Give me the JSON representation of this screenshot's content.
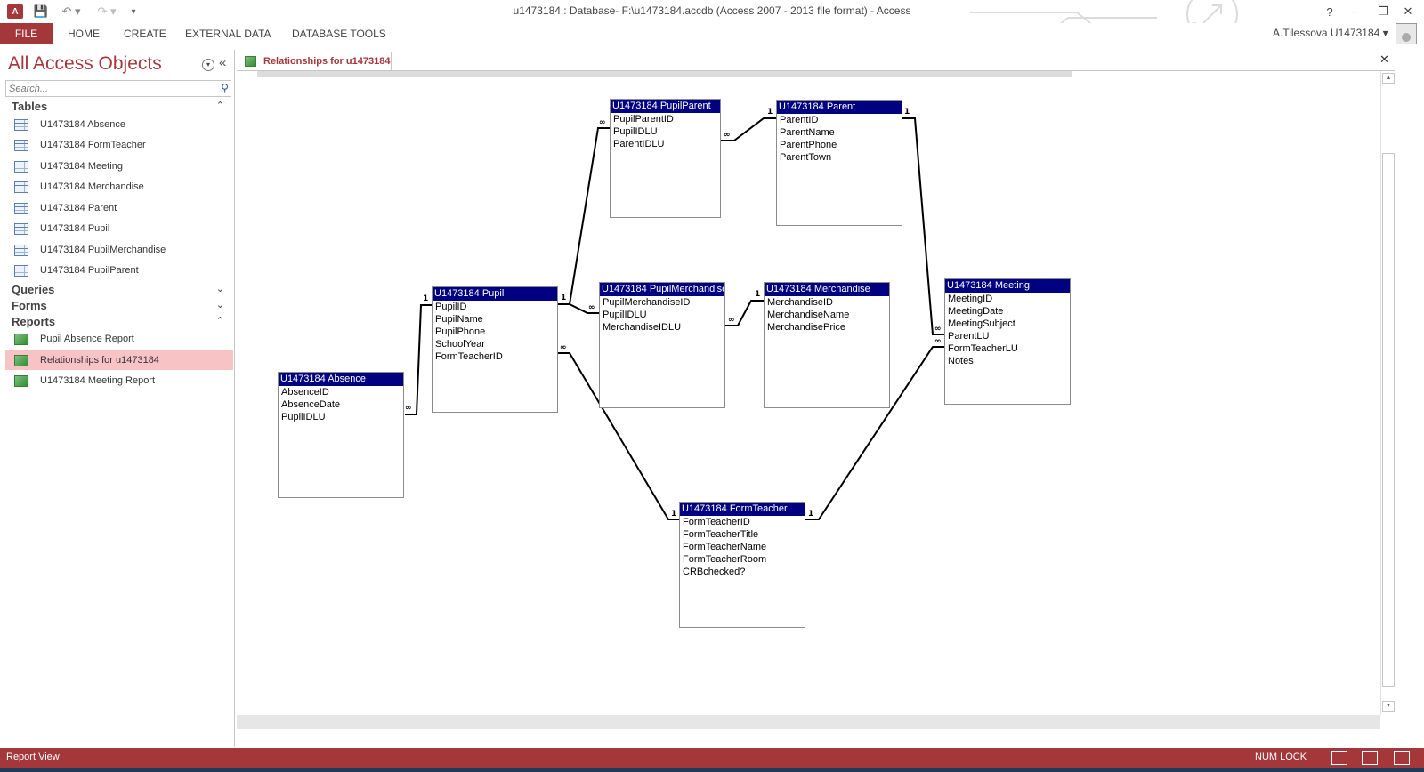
{
  "window": {
    "title": "u1473184 : Database- F:\\u1473184.accdb (Access 2007 - 2013 file format) - Access",
    "logo_text": "A",
    "help": "?",
    "minimize": "−",
    "maximize": "❐",
    "close": "✕"
  },
  "quick_access": {
    "save": "💾",
    "undo": "↶ ▾",
    "redo": "↷ ▾",
    "customize": "▾"
  },
  "ribbon": {
    "tabs": [
      "FILE",
      "HOME",
      "CREATE",
      "EXTERNAL DATA",
      "DATABASE TOOLS"
    ],
    "user": "A.Tilessova U1473184 ▾"
  },
  "nav": {
    "title": "All Access Objects",
    "menu_glyph": "▾",
    "collapse_glyph": "«",
    "search_placeholder": "Search...",
    "search_glyph": "⚲",
    "groups": {
      "tables": {
        "label": "Tables",
        "chevron": "⌃",
        "items": [
          "U1473184 Absence",
          "U1473184 FormTeacher",
          "U1473184 Meeting",
          "U1473184 Merchandise",
          "U1473184 Parent",
          "U1473184 Pupil",
          "U1473184 PupilMerchandise",
          "U1473184 PupilParent"
        ]
      },
      "queries": {
        "label": "Queries",
        "chevron": "⌄"
      },
      "forms": {
        "label": "Forms",
        "chevron": "⌄"
      },
      "reports": {
        "label": "Reports",
        "chevron": "⌃",
        "items": [
          "Pupil Absence Report",
          "Relationships for u1473184",
          "U1473184 Meeting Report"
        ],
        "selected_index": 1
      }
    }
  },
  "document": {
    "tab_label": "Relationships for u1473184",
    "close_glyph": "✕",
    "scroll_up": "▲",
    "scroll_down": "▼"
  },
  "diagram": {
    "tables": {
      "pupilparent": {
        "title": "U1473184 PupilParent",
        "fields": [
          "PupilParentID",
          "PupilIDLU",
          "ParentIDLU"
        ]
      },
      "parent": {
        "title": "U1473184 Parent",
        "fields": [
          "ParentID",
          "ParentName",
          "ParentPhone",
          "ParentTown"
        ]
      },
      "pupil": {
        "title": "U1473184 Pupil",
        "fields": [
          "PupilID",
          "PupilName",
          "PupilPhone",
          "SchoolYear",
          "FormTeacherID"
        ]
      },
      "pupilmerchandise": {
        "title": "U1473184 PupilMerchandise",
        "fields": [
          "PupilMerchandiseID",
          "PupilIDLU",
          "MerchandiseIDLU"
        ]
      },
      "merchandise": {
        "title": "U1473184 Merchandise",
        "fields": [
          "MerchandiseID",
          "MerchandiseName",
          "MerchandisePrice"
        ]
      },
      "meeting": {
        "title": "U1473184 Meeting",
        "fields": [
          "MeetingID",
          "MeetingDate",
          "MeetingSubject",
          "ParentLU",
          "FormTeacherLU",
          "Notes"
        ]
      },
      "absence": {
        "title": "U1473184 Absence",
        "fields": [
          "AbsenceID",
          "AbsenceDate",
          "PupilIDLU"
        ]
      },
      "formteacher": {
        "title": "U1473184 FormTeacher",
        "fields": [
          "FormTeacherID",
          "FormTeacherTitle",
          "FormTeacherName",
          "FormTeacherRoom",
          "CRBchecked?"
        ]
      }
    },
    "one_symbol": "1",
    "many_symbol": "∞"
  },
  "status": {
    "text": "Report View",
    "num_lock": "NUM LOCK"
  },
  "colors": {
    "accent": "#a4373a",
    "table_header": "#000080",
    "selected_item": "#f8c3c5"
  }
}
